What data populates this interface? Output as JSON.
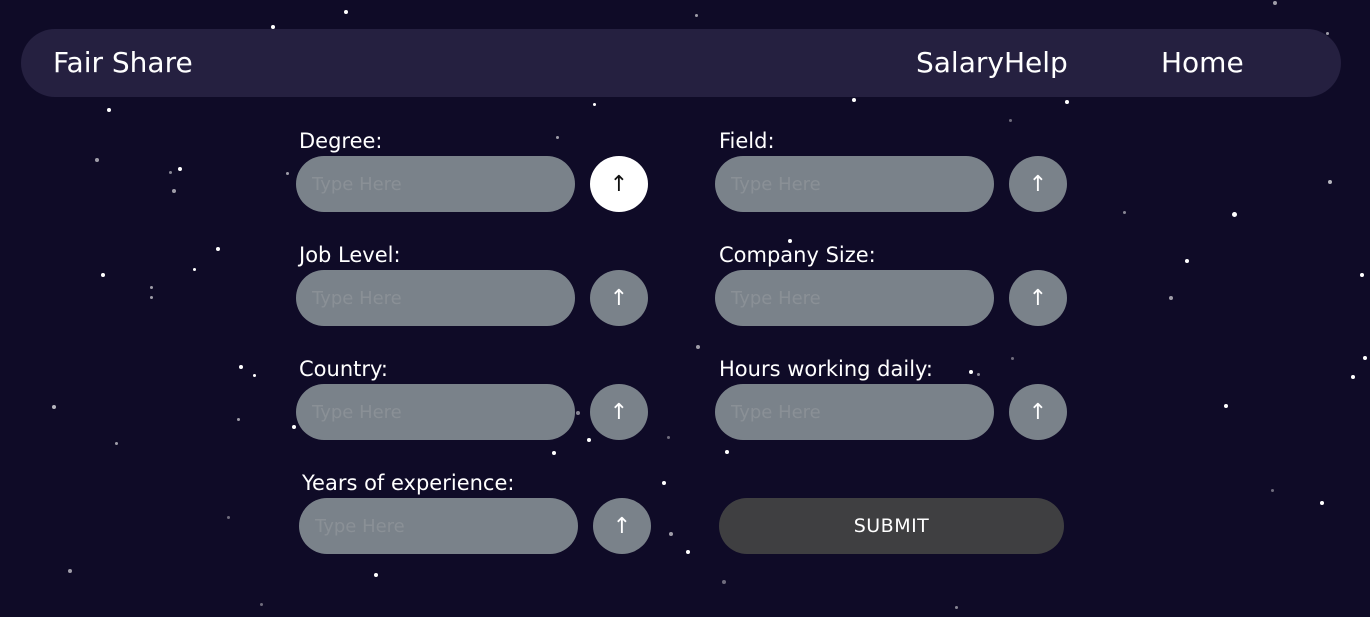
{
  "nav": {
    "brand": "Fair Share",
    "links": [
      "SalaryHelp",
      "Home"
    ]
  },
  "form": {
    "fields": [
      {
        "label": "Degree:",
        "placeholder": "Type Here",
        "button": "↑"
      },
      {
        "label": "Field:",
        "placeholder": "Type Here",
        "button": "↑"
      },
      {
        "label": "Job Level:",
        "placeholder": "Type Here",
        "button": "↑"
      },
      {
        "label": "Company Size:",
        "placeholder": "Type Here",
        "button": "↑"
      },
      {
        "label": "Country:",
        "placeholder": "Type Here",
        "button": "↑"
      },
      {
        "label": "Hours working daily:",
        "placeholder": "Type Here",
        "button": "↑"
      },
      {
        "label": "Years of experience:",
        "placeholder": "Type Here",
        "button": "↑"
      }
    ],
    "submit_label": "SUBMIT"
  },
  "colors": {
    "background": "#0f0b27",
    "navbar": "#252040",
    "input": "#7a828a",
    "submit": "#3f3f41",
    "active_button": "#ffffff"
  },
  "icons": {
    "submit_field": "arrow-up-icon"
  }
}
